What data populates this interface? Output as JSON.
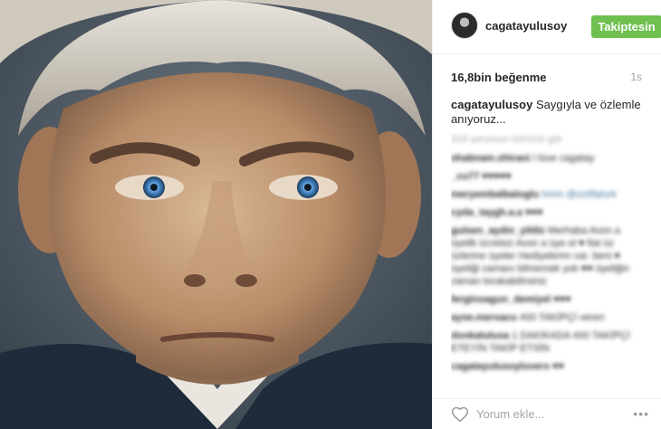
{
  "post": {
    "username": "cagatayulusoy",
    "follow_label": "Takiptesin",
    "likes": "16,8bin beğenme",
    "time": "1s",
    "caption": {
      "user": "cagatayulusoy",
      "text": "Saygıyla ve özlemle anıyoruz..."
    },
    "more_comments": "319 yorumun tümünü gör",
    "comments": [
      {
        "user": "shabnam.shirani",
        "text": "I love cagatay"
      },
      {
        "user": "_cu77",
        "text": "♥♥♥♥♥"
      },
      {
        "user": "meryembalbaloglu",
        "text": "hmm @ozilfaturk",
        "link": true
      },
      {
        "user": "cyda_taygh.a.a",
        "text": "♥♥♥"
      },
      {
        "user": "gulsen_aydin_yildiz",
        "text": "Merhaba Avon a üyelik ücretsiz Avon a üye ol ♥ fiat üz üzlerine üyeler Hediyelerim var. beni ♥ üyeliği zamanı bilmemek yok ♥♥ üyeliğin zaman bırakabilirsiniz"
      },
      {
        "user": "ferginsagun_demiyel",
        "text": "♥♥♥"
      },
      {
        "user": "ayse.mersacu",
        "text": "400 TAKİPÇİ veren"
      },
      {
        "user": "donkalulusa",
        "text": "1 DAKİKADA 400 TAKİPÇİ ETEYİN TAKİP ETSİN"
      },
      {
        "user": "cagatayulusoylovers",
        "text": "♥♥"
      }
    ],
    "add_comment_placeholder": "Yorum ekle...",
    "more_icon": "•••"
  },
  "icons": {
    "heart": "heart-icon",
    "more": "ellipsis-icon"
  },
  "colors": {
    "follow_button": "#70c050",
    "muted_text": "#a5a5a5",
    "link": "#3f729b"
  }
}
